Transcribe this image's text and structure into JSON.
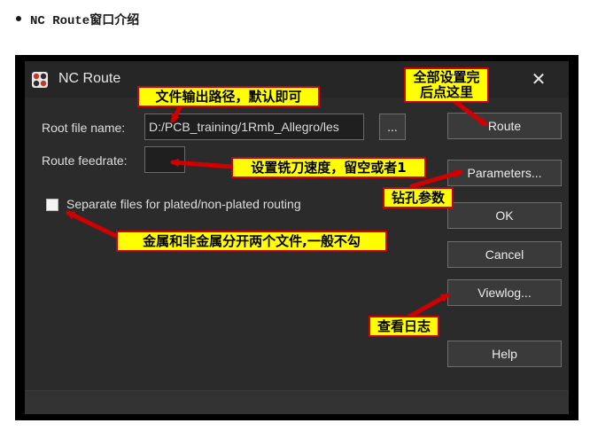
{
  "page": {
    "heading": "NC Route窗口介绍"
  },
  "window": {
    "title": "NC Route",
    "close_glyph": "✕",
    "icon": "nc-route-app-icon"
  },
  "form": {
    "root_file_label": "Root file name:",
    "root_file_value": "D:/PCB_training/1Rmb_Allegro/les",
    "browse_label": "...",
    "feedrate_label": "Route feedrate:",
    "feedrate_value": "",
    "separate_label": "Separate files for plated/non-plated routing",
    "separate_checked": false
  },
  "buttons": {
    "route": "Route",
    "parameters": "Parameters...",
    "ok": "OK",
    "cancel": "Cancel",
    "viewlog": "Viewlog...",
    "help": "Help"
  },
  "annotations": {
    "output_path": "文件输出路径，默认即可",
    "route_after_setup_line1": "全部设置完",
    "route_after_setup_line2": "后点这里",
    "feedrate": "设置铣刀速度，留空或者1",
    "drill_params": "钻孔参数",
    "separate_files": "金属和非金属分开两个文件,一般不勾",
    "view_log": "查看日志"
  },
  "colors": {
    "annotation_bg": "#ffff00",
    "annotation_border": "#d10000",
    "arrow": "#d10000",
    "dialog_bg": "#2b2b2b"
  }
}
